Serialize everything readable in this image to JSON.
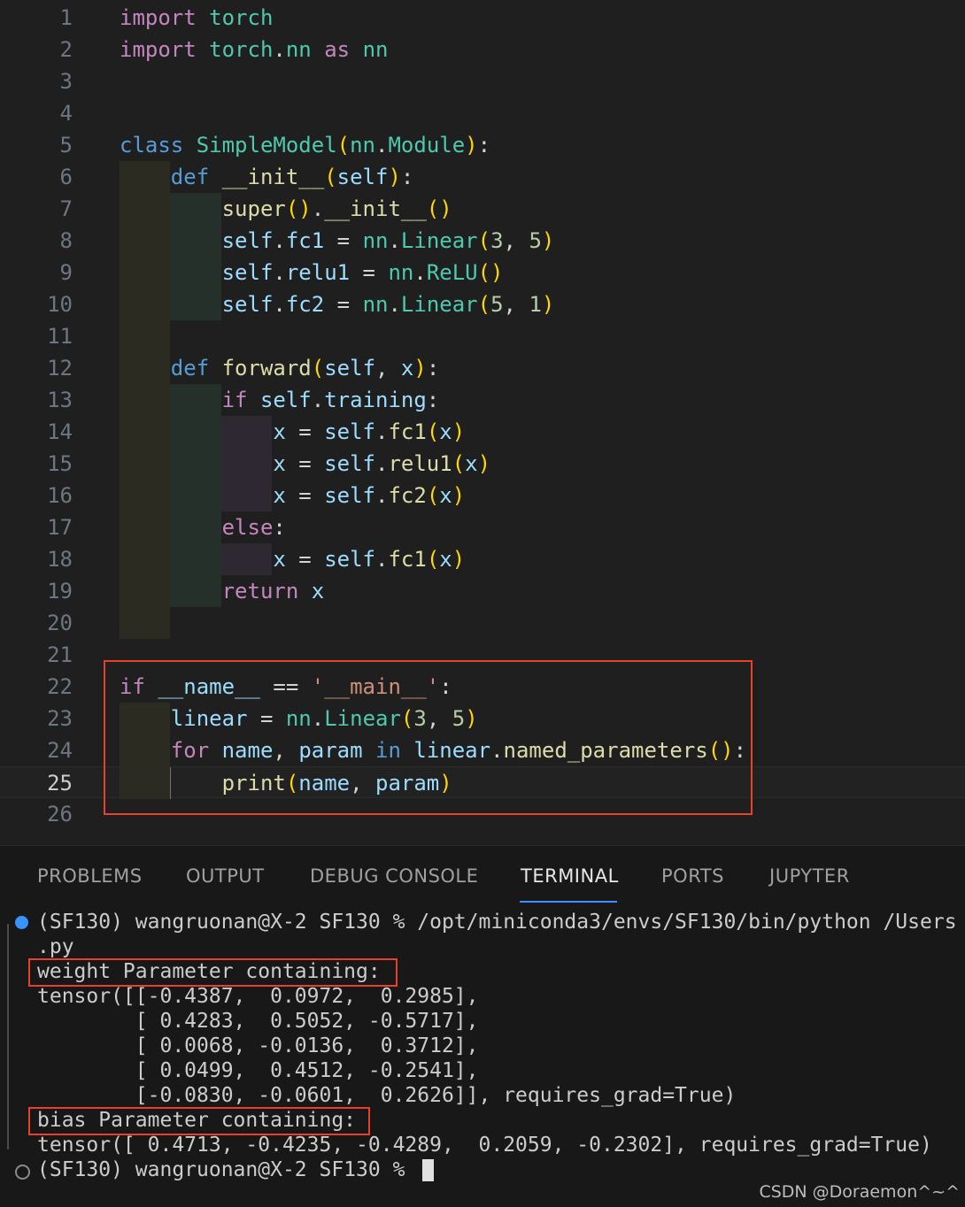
{
  "editor": {
    "current_line": 25,
    "lines": [
      {
        "n": "1",
        "guides": [],
        "tokens": [
          [
            "kw",
            "import"
          ],
          [
            "op",
            " "
          ],
          [
            "mod",
            "torch"
          ]
        ]
      },
      {
        "n": "2",
        "guides": [],
        "tokens": [
          [
            "kw",
            "import"
          ],
          [
            "op",
            " "
          ],
          [
            "mod",
            "torch"
          ],
          [
            "op",
            "."
          ],
          [
            "mod",
            "nn"
          ],
          [
            "op",
            " "
          ],
          [
            "kw",
            "as"
          ],
          [
            "op",
            " "
          ],
          [
            "mod",
            "nn"
          ]
        ]
      },
      {
        "n": "3",
        "guides": [],
        "tokens": []
      },
      {
        "n": "4",
        "guides": [],
        "tokens": []
      },
      {
        "n": "5",
        "guides": [],
        "tokens": [
          [
            "kwb",
            "class"
          ],
          [
            "op",
            " "
          ],
          [
            "cls",
            "SimpleModel"
          ],
          [
            "br",
            "("
          ],
          [
            "mod",
            "nn"
          ],
          [
            "op",
            "."
          ],
          [
            "cls",
            "Module"
          ],
          [
            "br",
            ")"
          ],
          [
            "op",
            ":"
          ]
        ]
      },
      {
        "n": "6",
        "guides": [
          1
        ],
        "tokens": [
          [
            "op",
            "    "
          ],
          [
            "kwb",
            "def"
          ],
          [
            "op",
            " "
          ],
          [
            "fn",
            "__init__"
          ],
          [
            "br",
            "("
          ],
          [
            "var",
            "self"
          ],
          [
            "br",
            ")"
          ],
          [
            "op",
            ":"
          ]
        ]
      },
      {
        "n": "7",
        "guides": [
          1,
          2
        ],
        "tokens": [
          [
            "op",
            "        "
          ],
          [
            "fn",
            "super"
          ],
          [
            "br",
            "()"
          ],
          [
            "op",
            "."
          ],
          [
            "fn",
            "__init__"
          ],
          [
            "br",
            "()"
          ]
        ]
      },
      {
        "n": "8",
        "guides": [
          1,
          2
        ],
        "tokens": [
          [
            "op",
            "        "
          ],
          [
            "var",
            "self"
          ],
          [
            "op",
            "."
          ],
          [
            "var",
            "fc1"
          ],
          [
            "op",
            " = "
          ],
          [
            "mod",
            "nn"
          ],
          [
            "op",
            "."
          ],
          [
            "cls",
            "Linear"
          ],
          [
            "br",
            "("
          ],
          [
            "num",
            "3"
          ],
          [
            "op",
            ", "
          ],
          [
            "num",
            "5"
          ],
          [
            "br",
            ")"
          ]
        ]
      },
      {
        "n": "9",
        "guides": [
          1,
          2
        ],
        "tokens": [
          [
            "op",
            "        "
          ],
          [
            "var",
            "self"
          ],
          [
            "op",
            "."
          ],
          [
            "var",
            "relu1"
          ],
          [
            "op",
            " = "
          ],
          [
            "mod",
            "nn"
          ],
          [
            "op",
            "."
          ],
          [
            "cls",
            "ReLU"
          ],
          [
            "br",
            "()"
          ]
        ]
      },
      {
        "n": "10",
        "guides": [
          1,
          2
        ],
        "tokens": [
          [
            "op",
            "        "
          ],
          [
            "var",
            "self"
          ],
          [
            "op",
            "."
          ],
          [
            "var",
            "fc2"
          ],
          [
            "op",
            " = "
          ],
          [
            "mod",
            "nn"
          ],
          [
            "op",
            "."
          ],
          [
            "cls",
            "Linear"
          ],
          [
            "br",
            "("
          ],
          [
            "num",
            "5"
          ],
          [
            "op",
            ", "
          ],
          [
            "num",
            "1"
          ],
          [
            "br",
            ")"
          ]
        ]
      },
      {
        "n": "11",
        "guides": [
          1
        ],
        "tokens": []
      },
      {
        "n": "12",
        "guides": [
          1
        ],
        "tokens": [
          [
            "op",
            "    "
          ],
          [
            "kwb",
            "def"
          ],
          [
            "op",
            " "
          ],
          [
            "fn",
            "forward"
          ],
          [
            "br",
            "("
          ],
          [
            "var",
            "self"
          ],
          [
            "op",
            ", "
          ],
          [
            "var",
            "x"
          ],
          [
            "br",
            ")"
          ],
          [
            "op",
            ":"
          ]
        ]
      },
      {
        "n": "13",
        "guides": [
          1,
          2
        ],
        "tokens": [
          [
            "op",
            "        "
          ],
          [
            "kw",
            "if"
          ],
          [
            "op",
            " "
          ],
          [
            "var",
            "self"
          ],
          [
            "op",
            "."
          ],
          [
            "var",
            "training"
          ],
          [
            "op",
            ":"
          ]
        ]
      },
      {
        "n": "14",
        "guides": [
          1,
          2,
          3
        ],
        "tokens": [
          [
            "op",
            "            "
          ],
          [
            "var",
            "x"
          ],
          [
            "op",
            " = "
          ],
          [
            "var",
            "self"
          ],
          [
            "op",
            "."
          ],
          [
            "fn",
            "fc1"
          ],
          [
            "br",
            "("
          ],
          [
            "var",
            "x"
          ],
          [
            "br",
            ")"
          ]
        ]
      },
      {
        "n": "15",
        "guides": [
          1,
          2,
          3
        ],
        "tokens": [
          [
            "op",
            "            "
          ],
          [
            "var",
            "x"
          ],
          [
            "op",
            " = "
          ],
          [
            "var",
            "self"
          ],
          [
            "op",
            "."
          ],
          [
            "fn",
            "relu1"
          ],
          [
            "br",
            "("
          ],
          [
            "var",
            "x"
          ],
          [
            "br",
            ")"
          ]
        ]
      },
      {
        "n": "16",
        "guides": [
          1,
          2,
          3
        ],
        "tokens": [
          [
            "op",
            "            "
          ],
          [
            "var",
            "x"
          ],
          [
            "op",
            " = "
          ],
          [
            "var",
            "self"
          ],
          [
            "op",
            "."
          ],
          [
            "fn",
            "fc2"
          ],
          [
            "br",
            "("
          ],
          [
            "var",
            "x"
          ],
          [
            "br",
            ")"
          ]
        ]
      },
      {
        "n": "17",
        "guides": [
          1,
          2
        ],
        "tokens": [
          [
            "op",
            "        "
          ],
          [
            "kw",
            "else"
          ],
          [
            "op",
            ":"
          ]
        ]
      },
      {
        "n": "18",
        "guides": [
          1,
          2,
          3
        ],
        "tokens": [
          [
            "op",
            "            "
          ],
          [
            "var",
            "x"
          ],
          [
            "op",
            " = "
          ],
          [
            "var",
            "self"
          ],
          [
            "op",
            "."
          ],
          [
            "fn",
            "fc1"
          ],
          [
            "br",
            "("
          ],
          [
            "var",
            "x"
          ],
          [
            "br",
            ")"
          ]
        ]
      },
      {
        "n": "19",
        "guides": [
          1,
          2
        ],
        "tokens": [
          [
            "op",
            "        "
          ],
          [
            "kw",
            "return"
          ],
          [
            "op",
            " "
          ],
          [
            "var",
            "x"
          ]
        ]
      },
      {
        "n": "20",
        "guides": [
          1
        ],
        "tokens": []
      },
      {
        "n": "21",
        "guides": [],
        "tokens": []
      },
      {
        "n": "22",
        "guides": [],
        "tokens": [
          [
            "kw",
            "if"
          ],
          [
            "op",
            " "
          ],
          [
            "var",
            "__name__"
          ],
          [
            "op",
            " == "
          ],
          [
            "str",
            "'__main__'"
          ],
          [
            "op",
            ":"
          ]
        ]
      },
      {
        "n": "23",
        "guides": [
          1
        ],
        "tokens": [
          [
            "op",
            "    "
          ],
          [
            "var",
            "linear"
          ],
          [
            "op",
            " = "
          ],
          [
            "mod",
            "nn"
          ],
          [
            "op",
            "."
          ],
          [
            "cls",
            "Linear"
          ],
          [
            "br",
            "("
          ],
          [
            "num",
            "3"
          ],
          [
            "op",
            ", "
          ],
          [
            "num",
            "5"
          ],
          [
            "br",
            ")"
          ]
        ]
      },
      {
        "n": "24",
        "guides": [
          1
        ],
        "tokens": [
          [
            "op",
            "    "
          ],
          [
            "kw",
            "for"
          ],
          [
            "op",
            " "
          ],
          [
            "var",
            "name"
          ],
          [
            "op",
            ", "
          ],
          [
            "var",
            "param"
          ],
          [
            "op",
            " "
          ],
          [
            "kwb",
            "in"
          ],
          [
            "op",
            " "
          ],
          [
            "var",
            "linear"
          ],
          [
            "op",
            "."
          ],
          [
            "fn",
            "named_parameters"
          ],
          [
            "br",
            "()"
          ],
          [
            "op",
            ":"
          ]
        ]
      },
      {
        "n": "25",
        "guides": [
          1,
          "x"
        ],
        "tokens": [
          [
            "op",
            "        "
          ],
          [
            "fn",
            "print"
          ],
          [
            "br",
            "("
          ],
          [
            "var",
            "name"
          ],
          [
            "op",
            ", "
          ],
          [
            "var",
            "param"
          ],
          [
            "br",
            ")"
          ]
        ]
      },
      {
        "n": "26",
        "guides": [],
        "tokens": []
      }
    ]
  },
  "panel": {
    "tabs": [
      "PROBLEMS",
      "OUTPUT",
      "DEBUG CONSOLE",
      "TERMINAL",
      "PORTS",
      "JUPYTER"
    ],
    "active_tab": "TERMINAL",
    "terminal": {
      "command_line": "(SF130) wangruonan@X-2 SF130 % /opt/miniconda3/envs/SF130/bin/python /Users",
      "command_cont": ".py",
      "weight_header": "weight Parameter containing:",
      "weight_rows": [
        "tensor([[-0.4387,  0.0972,  0.2985],",
        "        [ 0.4283,  0.5052, -0.5717],",
        "        [ 0.0068, -0.0136,  0.3712],",
        "        [ 0.0499,  0.4512, -0.2541],",
        "        [-0.0830, -0.0601,  0.2626]], requires_grad=True)"
      ],
      "bias_header": "bias Parameter containing:",
      "bias_row": "tensor([ 0.4713, -0.4235, -0.4289,  0.2059, -0.2302], requires_grad=True)",
      "prompt": "(SF130) wangruonan@X-2 SF130 % "
    }
  },
  "watermark": "CSDN @Doraemon^~^"
}
